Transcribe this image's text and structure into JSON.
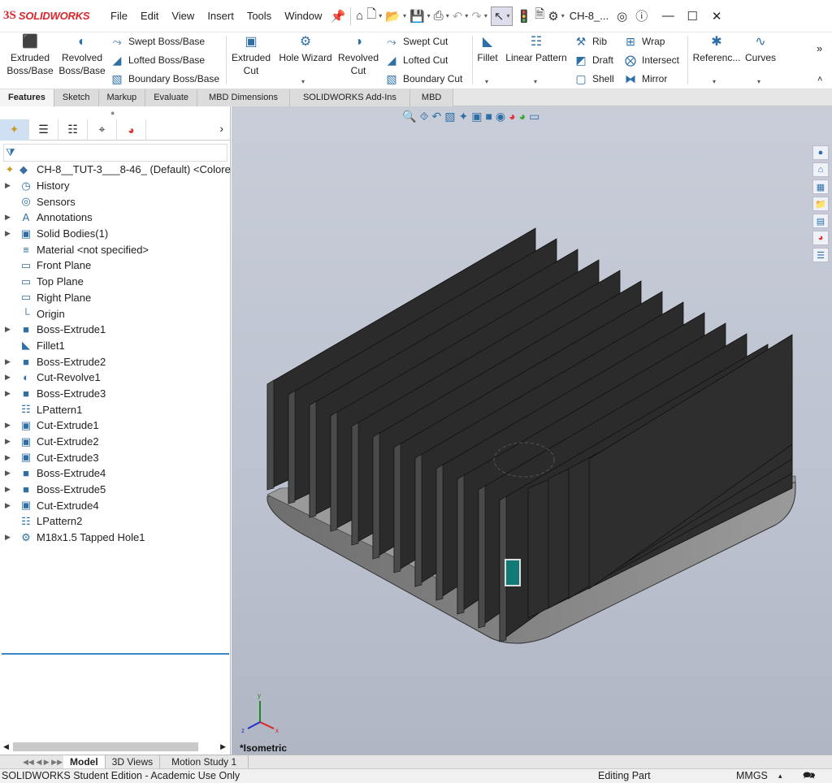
{
  "app": {
    "logo_mark": "3S",
    "logo_text": "SOLIDWORKS"
  },
  "menu": [
    "File",
    "Edit",
    "View",
    "Insert",
    "Tools",
    "Window"
  ],
  "title": {
    "document": "CH-8_..."
  },
  "command_manager": {
    "extruded_boss": "Extruded\nBoss/Base",
    "revolved_boss": "Revolved\nBoss/Base",
    "swept_boss": "Swept Boss/Base",
    "lofted_boss": "Lofted Boss/Base",
    "boundary_boss": "Boundary Boss/Base",
    "extruded_cut": "Extruded\nCut",
    "hole_wizard": "Hole Wizard",
    "revolved_cut": "Revolved\nCut",
    "swept_cut": "Swept Cut",
    "lofted_cut": "Lofted Cut",
    "boundary_cut": "Boundary Cut",
    "fillet": "Fillet",
    "linear_pattern": "Linear Pattern",
    "rib": "Rib",
    "draft": "Draft",
    "shell": "Shell",
    "wrap": "Wrap",
    "intersect": "Intersect",
    "mirror": "Mirror",
    "reference": "Referenc...",
    "curves": "Curves"
  },
  "tabs": [
    "Features",
    "Sketch",
    "Markup",
    "Evaluate",
    "MBD Dimensions",
    "SOLIDWORKS Add-Ins",
    "MBD"
  ],
  "active_tab": "Features",
  "feature_tree": {
    "root": "CH-8__TUT-3___8-46_ (Default) <Colore",
    "items": [
      {
        "label": "History",
        "icon": "history-icon",
        "expandable": true
      },
      {
        "label": "Sensors",
        "icon": "sensor-icon",
        "expandable": false
      },
      {
        "label": "Annotations",
        "icon": "annotation-icon",
        "expandable": true
      },
      {
        "label": "Solid Bodies(1)",
        "icon": "solid-bodies-icon",
        "expandable": true
      },
      {
        "label": "Material <not specified>",
        "icon": "material-icon",
        "expandable": false
      },
      {
        "label": "Front Plane",
        "icon": "plane-icon",
        "expandable": false
      },
      {
        "label": "Top Plane",
        "icon": "plane-icon",
        "expandable": false
      },
      {
        "label": "Right Plane",
        "icon": "plane-icon",
        "expandable": false
      },
      {
        "label": "Origin",
        "icon": "origin-icon",
        "expandable": false
      },
      {
        "label": "Boss-Extrude1",
        "icon": "extrude-icon",
        "expandable": true
      },
      {
        "label": "Fillet1",
        "icon": "fillet-icon",
        "expandable": false
      },
      {
        "label": "Boss-Extrude2",
        "icon": "extrude-icon",
        "expandable": true
      },
      {
        "label": "Cut-Revolve1",
        "icon": "revolve-icon",
        "expandable": true
      },
      {
        "label": "Boss-Extrude3",
        "icon": "extrude-icon",
        "expandable": true
      },
      {
        "label": "LPattern1",
        "icon": "pattern-icon",
        "expandable": false
      },
      {
        "label": "Cut-Extrude1",
        "icon": "cut-icon",
        "expandable": true
      },
      {
        "label": "Cut-Extrude2",
        "icon": "cut-icon",
        "expandable": true
      },
      {
        "label": "Cut-Extrude3",
        "icon": "cut-icon",
        "expandable": true
      },
      {
        "label": "Boss-Extrude4",
        "icon": "extrude-icon",
        "expandable": true
      },
      {
        "label": "Boss-Extrude5",
        "icon": "extrude-icon",
        "expandable": true
      },
      {
        "label": "Cut-Extrude4",
        "icon": "cut-icon",
        "expandable": true
      },
      {
        "label": "LPattern2",
        "icon": "pattern-icon",
        "expandable": false
      },
      {
        "label": "M18x1.5 Tapped Hole1",
        "icon": "hole-icon",
        "expandable": true
      }
    ]
  },
  "viewport": {
    "view_name": "*Isometric",
    "triad": {
      "x": "x",
      "y": "y",
      "z": "z"
    }
  },
  "bottom_tabs": [
    "Model",
    "3D Views",
    "Motion Study 1"
  ],
  "active_bottom_tab": "Model",
  "status": {
    "left": "SOLIDWORKS Student Edition - Academic Use Only",
    "mode": "Editing Part",
    "units": "MMGS"
  },
  "colors": {
    "accent": "#2f6fa8",
    "brand": "#d9262c",
    "model_fin": "#2b2b2b",
    "model_base": "#8a8a8a",
    "viewport_bg": "#c4c9d5"
  }
}
